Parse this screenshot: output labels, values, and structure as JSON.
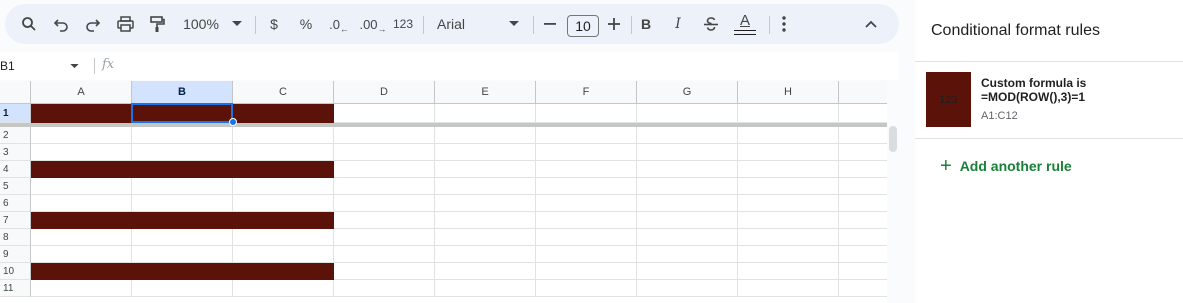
{
  "toolbar": {
    "zoom": "100%",
    "currency": "$",
    "percent": "%",
    "dec_decrease": ".0",
    "dec_increase": ".00",
    "number_format": "123",
    "font_family": "Arial",
    "font_size": "10",
    "bold": "B",
    "italic": "I",
    "text_color": "A"
  },
  "formula_bar": {
    "cell_ref": "B1",
    "fx": "fx",
    "value": ""
  },
  "grid": {
    "columns": [
      "A",
      "B",
      "C",
      "D",
      "E",
      "F",
      "G",
      "H"
    ],
    "rows": [
      "1",
      "2",
      "3",
      "4",
      "5",
      "6",
      "7",
      "8",
      "9",
      "10",
      "11"
    ],
    "selected_cell": "B1",
    "highlight_color": "#5b1208",
    "highlighted_rows": [
      1,
      4,
      7,
      10
    ]
  },
  "panel": {
    "title": "Conditional format rules",
    "rule": {
      "preview": "123",
      "condition_line1": "Custom formula is",
      "condition_line2": "=MOD(ROW(),3)=1",
      "range": "A1:C12",
      "color": "#5b1208"
    },
    "add_rule": "Add another rule"
  }
}
